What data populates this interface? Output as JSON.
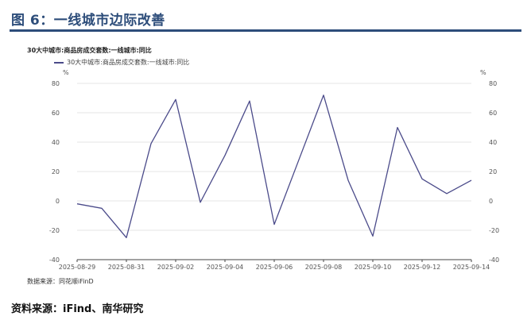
{
  "figure": {
    "title": "图 6：一线城市边际改善",
    "source_note": "资料来源：iFind、南华研究"
  },
  "chart_data": {
    "type": "line",
    "title": "30大中城市:商品房成交套数:一线城市:同比",
    "y_unit_left": "%",
    "y_unit_right": "%",
    "ylim": [
      -40,
      80
    ],
    "yticks": [
      -40,
      -20,
      0,
      20,
      40,
      60,
      80
    ],
    "x_tick_labels": [
      "2025-08-29",
      "2025-08-31",
      "2025-09-02",
      "2025-09-04",
      "2025-09-06",
      "2025-09-08",
      "2025-09-10",
      "2025-09-12",
      "2025-09-14"
    ],
    "x": [
      "2025-08-29",
      "2025-08-30",
      "2025-08-31",
      "2025-09-01",
      "2025-09-02",
      "2025-09-03",
      "2025-09-04",
      "2025-09-05",
      "2025-09-06",
      "2025-09-07",
      "2025-09-08",
      "2025-09-09",
      "2025-09-10",
      "2025-09-11",
      "2025-09-12",
      "2025-09-13",
      "2025-09-14"
    ],
    "series": [
      {
        "name": "30大中城市:商品房成交套数:一线城市:同比",
        "color": "#4b4b8a",
        "values": [
          -2,
          -5,
          -25,
          39,
          69,
          -1,
          31,
          68,
          -16,
          28,
          72,
          14,
          -24,
          50,
          15,
          5,
          14
        ]
      }
    ],
    "grid": "horizontal",
    "legend_position": "top-left",
    "source": "数据来源：同花顺iFinD"
  }
}
